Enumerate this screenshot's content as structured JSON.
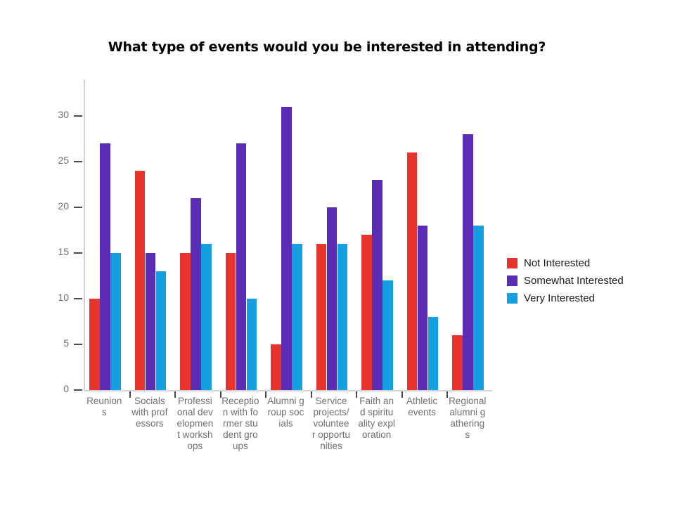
{
  "chart_data": {
    "type": "bar",
    "title": "What type of events would you be interested in attending?",
    "xlabel": "",
    "ylabel": "",
    "ylim": [
      0,
      34
    ],
    "yticks": [
      0,
      5,
      10,
      15,
      20,
      25,
      30
    ],
    "grid": false,
    "legend_position": "right",
    "categories": [
      "Reunions",
      "Socials with professors",
      "Professional development workshops",
      "Reception with former student groups",
      "Alumni group socials",
      "Service projects/volunteer opportunities",
      "Faith and spirituality exploration",
      "Athletic events",
      "Regional alumni gatherings"
    ],
    "series": [
      {
        "name": "Not Interested",
        "color": "#e8342a",
        "values": [
          10,
          24,
          15,
          15,
          5,
          16,
          17,
          26,
          6
        ]
      },
      {
        "name": "Somewhat Interested",
        "color": "#5b2cb5",
        "values": [
          27,
          15,
          21,
          27,
          31,
          20,
          23,
          18,
          28
        ]
      },
      {
        "name": "Very Interested",
        "color": "#159fe3",
        "values": [
          15,
          13,
          16,
          10,
          16,
          16,
          12,
          8,
          18
        ]
      }
    ]
  },
  "axis": {
    "tick_color": "#6f6f6f",
    "spine_color": "#d2d2d2"
  }
}
